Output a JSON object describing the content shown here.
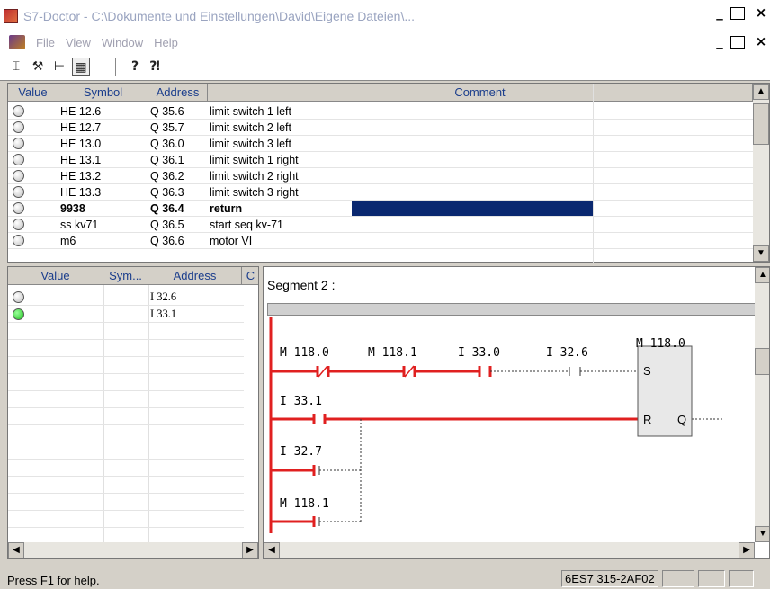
{
  "window": {
    "title": "S7-Doctor - C:\\Dokumente und Einstellungen\\David\\Eigene Dateien\\...",
    "min_glyph": "_",
    "max_glyph": "□",
    "close_glyph": "×",
    "restore_glyph": "🗗"
  },
  "menu": [
    "File",
    "View",
    "Window",
    "Help"
  ],
  "toolbar": {
    "icons": [
      "text-cursor-icon",
      "settings-tool-icon",
      "tree-icon",
      "module-icon",
      "help-icon",
      "context-help-icon"
    ],
    "glyphs": [
      "⌶",
      "⚒",
      "⊢",
      "▦",
      "?",
      "⁈"
    ]
  },
  "top_table": {
    "headers": [
      "Value",
      "Symbol",
      "Address",
      "Comment"
    ],
    "rows": [
      {
        "symbol": "HE 12.6",
        "address": "Q 35.6",
        "comment": "limit switch 1 left",
        "bold": false
      },
      {
        "symbol": "HE 12.7",
        "address": "Q 35.7",
        "comment": "limit switch 2 left",
        "bold": false
      },
      {
        "symbol": "HE 13.0",
        "address": "Q 36.0",
        "comment": "limit switch 3 left",
        "bold": false
      },
      {
        "symbol": "HE 13.1",
        "address": "Q 36.1",
        "comment": "limit switch 1 right",
        "bold": false
      },
      {
        "symbol": "HE 13.2",
        "address": "Q 36.2",
        "comment": "limit switch 2 right",
        "bold": false
      },
      {
        "symbol": "HE 13.3",
        "address": "Q 36.3",
        "comment": "limit switch 3 right",
        "bold": false
      },
      {
        "symbol": "9938",
        "address": "Q 36.4",
        "comment": "return",
        "bold": true
      },
      {
        "symbol": "ss kv71",
        "address": "Q 36.5",
        "comment": "start seq kv-71",
        "bold": false
      },
      {
        "symbol": "m6",
        "address": "Q 36.6",
        "comment": "motor VI",
        "bold": false
      }
    ]
  },
  "left_table": {
    "headers": [
      "Value",
      "Sym...",
      "Address",
      "C"
    ],
    "rows": [
      {
        "address": "I 32.6",
        "state": "off"
      },
      {
        "address": "I 33.1",
        "state": "on"
      }
    ]
  },
  "segment": {
    "label": "Segment 2 :",
    "contacts": [
      "M 118.0",
      "M 118.1",
      "I 33.0",
      "I 32.6",
      "I 33.1",
      "I 32.7",
      "M 118.1"
    ],
    "box_label": "M 118.0",
    "pins": [
      "S",
      "R",
      "Q"
    ]
  },
  "status": {
    "help": "Press F1 for help.",
    "cpu": "6ES7 315-2AF02"
  },
  "colors": {
    "rung": "#e02020",
    "selection": "#0a2870",
    "led_on": "#20c020",
    "header_text": "#1a3d8c"
  }
}
